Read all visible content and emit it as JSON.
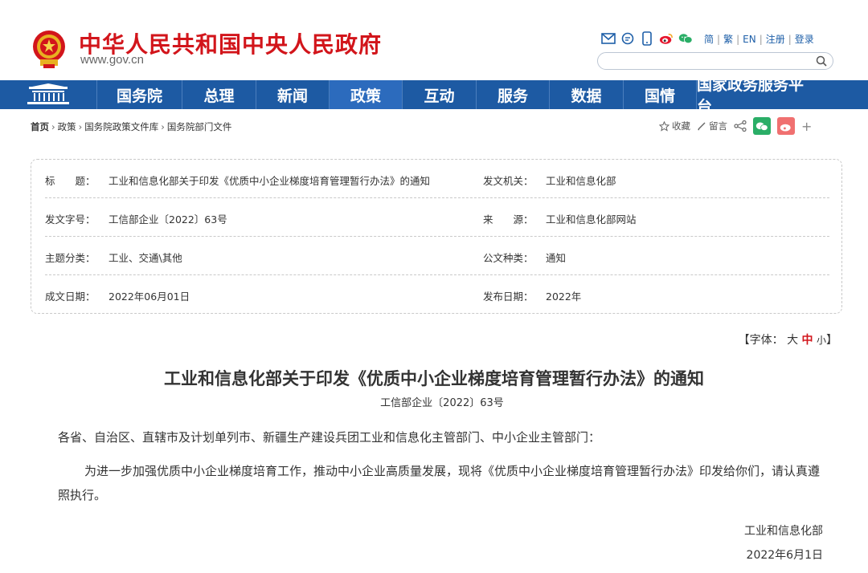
{
  "header": {
    "site_title": "中华人民共和国中央人民政府",
    "site_url": "www.gov.cn",
    "util_links": [
      "简",
      "繁",
      "EN",
      "注册",
      "登录"
    ],
    "util_icons": [
      "mail-icon",
      "chat-bubble-icon",
      "mobile-icon",
      "weibo-icon",
      "wechat-icon"
    ],
    "search_placeholder": ""
  },
  "nav": {
    "items": [
      "国务院",
      "总理",
      "新闻",
      "政策",
      "互动",
      "服务",
      "数据",
      "国情",
      "国家政务服务平台"
    ],
    "active": "政策"
  },
  "breadcrumb": {
    "items": [
      "首页",
      "政策",
      "国务院政策文件库",
      "国务院部门文件"
    ]
  },
  "tools": {
    "favorite": "收藏",
    "comment": "留言"
  },
  "info": {
    "rows": [
      {
        "l1": "标　　题：",
        "v1": "工业和信息化部关于印发《优质中小企业梯度培育管理暂行办法》的通知",
        "l2": "发文机关：",
        "v2": "工业和信息化部"
      },
      {
        "l1": "发文字号：",
        "v1": "工信部企业〔2022〕63号",
        "l2": "来　　源：",
        "v2": "工业和信息化部网站"
      },
      {
        "l1": "主题分类：",
        "v1": "工业、交通\\其他",
        "l2": "公文种类：",
        "v2": "通知"
      },
      {
        "l1": "成文日期：",
        "v1": "2022年06月01日",
        "l2": "发布日期：",
        "v2": "2022年"
      }
    ]
  },
  "fontsize": {
    "label": "【字体：",
    "big": "大",
    "mid": "中",
    "small": "小",
    "end": "】"
  },
  "article": {
    "title": "工业和信息化部关于印发《优质中小企业梯度培育管理暂行办法》的通知",
    "doc_no": "工信部企业〔2022〕63号",
    "recipients": "各省、自治区、直辖市及计划单列市、新疆生产建设兵团工业和信息化主管部门、中小企业主管部门：",
    "body": "为进一步加强优质中小企业梯度培育工作，推动中小企业高质量发展，现将《优质中小企业梯度培育管理暂行办法》印发给你们，请认真遵照执行。",
    "signer": "工业和信息化部",
    "date": "2022年6月1日"
  },
  "colors": {
    "brand_red": "#d2151b",
    "nav_blue": "#1d5aa3",
    "nav_active": "#2c6bbd"
  }
}
